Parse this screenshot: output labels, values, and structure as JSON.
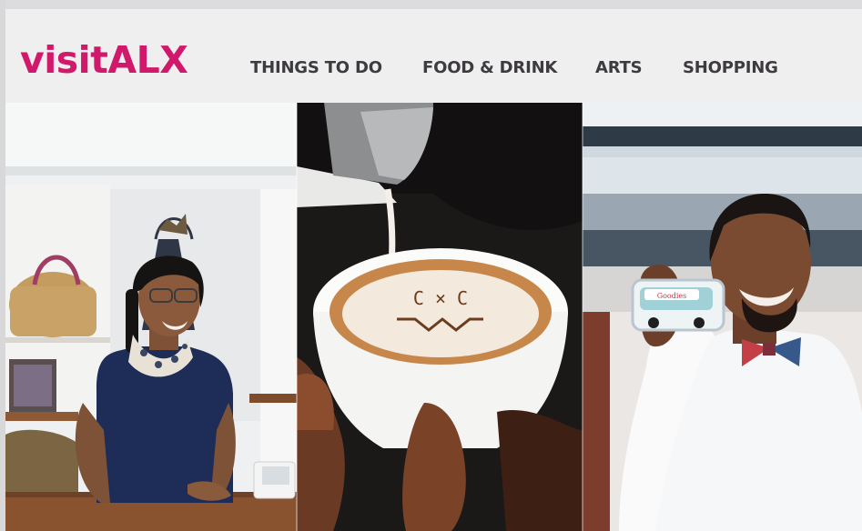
{
  "brand": {
    "logo_text": "visitALX",
    "accent": "#d1196b"
  },
  "nav": {
    "items": [
      {
        "label": "THINGS TO DO"
      },
      {
        "label": "FOOD & DRINK"
      },
      {
        "label": "ARTS"
      },
      {
        "label": "SHOPPING"
      }
    ]
  },
  "hero": {
    "panels": [
      {
        "subject": "woman smiling at shop counter with bags on shelves"
      },
      {
        "subject": "milk being poured into a latte with foam art"
      },
      {
        "subject": "man in bow tie holding a food-truck sticker"
      }
    ],
    "truck_sign": "Goodies"
  }
}
